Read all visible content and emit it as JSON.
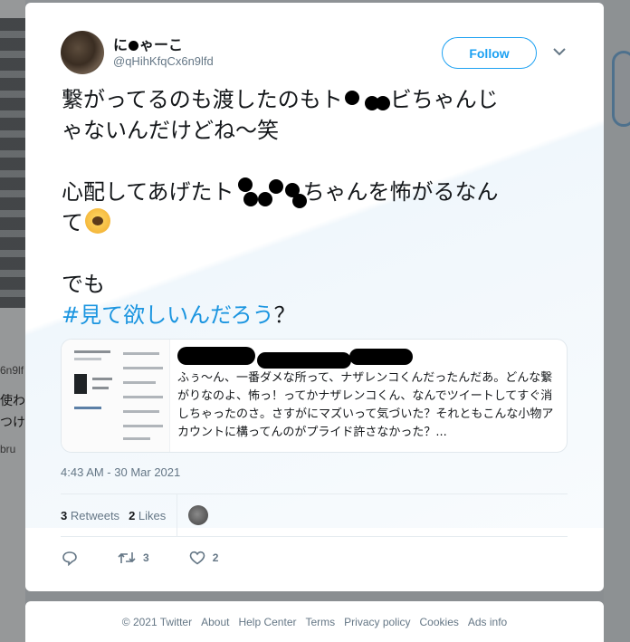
{
  "tweet": {
    "display_name_prefix": "に",
    "display_name_suffix": "ゃーこ",
    "handle": "@qHihKfqCx6n9lfd",
    "follow_label": "Follow",
    "line1_part1": "繋がってるのも渡したのもト",
    "line1_part2": "ビちゃんじ",
    "line2": "ゃないんだけどね〜笑",
    "line3_part1": "心配してあげたト",
    "line3_part2": "ちゃんを怖がるなん",
    "line4": "て",
    "line5": "でも",
    "hashtag": "#見て欲しいんだろう",
    "hashtag_suffix": "？",
    "timestamp": "4:43 AM - 30 Mar 2021"
  },
  "link_card": {
    "description": "ふぅ～ん、一番ダメな所って、ナザレンコくんだったんだあ。どんな繋がりなのよ、怖っ！ってかナザレンコくん、なんでツイートしてすぐ消しちゃったのさ。さすがにマズいって気づいた？それともこんな小物アカウントに構ってんのがプライド許さなかった？..."
  },
  "stats": {
    "retweets_count": "3",
    "retweets_label": "Retweets",
    "likes_count": "2",
    "likes_label": "Likes"
  },
  "actions": {
    "retweet_count": "3",
    "like_count": "2"
  },
  "footer": {
    "copyright": "© 2021 Twitter",
    "links": [
      "About",
      "Help Center",
      "Terms",
      "Privacy policy",
      "Cookies",
      "Ads info"
    ]
  },
  "background": {
    "left_snippets": [
      "6n9lf",
      "使わ",
      "つけ",
      "bru"
    ]
  },
  "colors": {
    "accent": "#1da1f2",
    "hashtag": "#1b95e0",
    "text": "#14171a",
    "muted": "#657786"
  }
}
